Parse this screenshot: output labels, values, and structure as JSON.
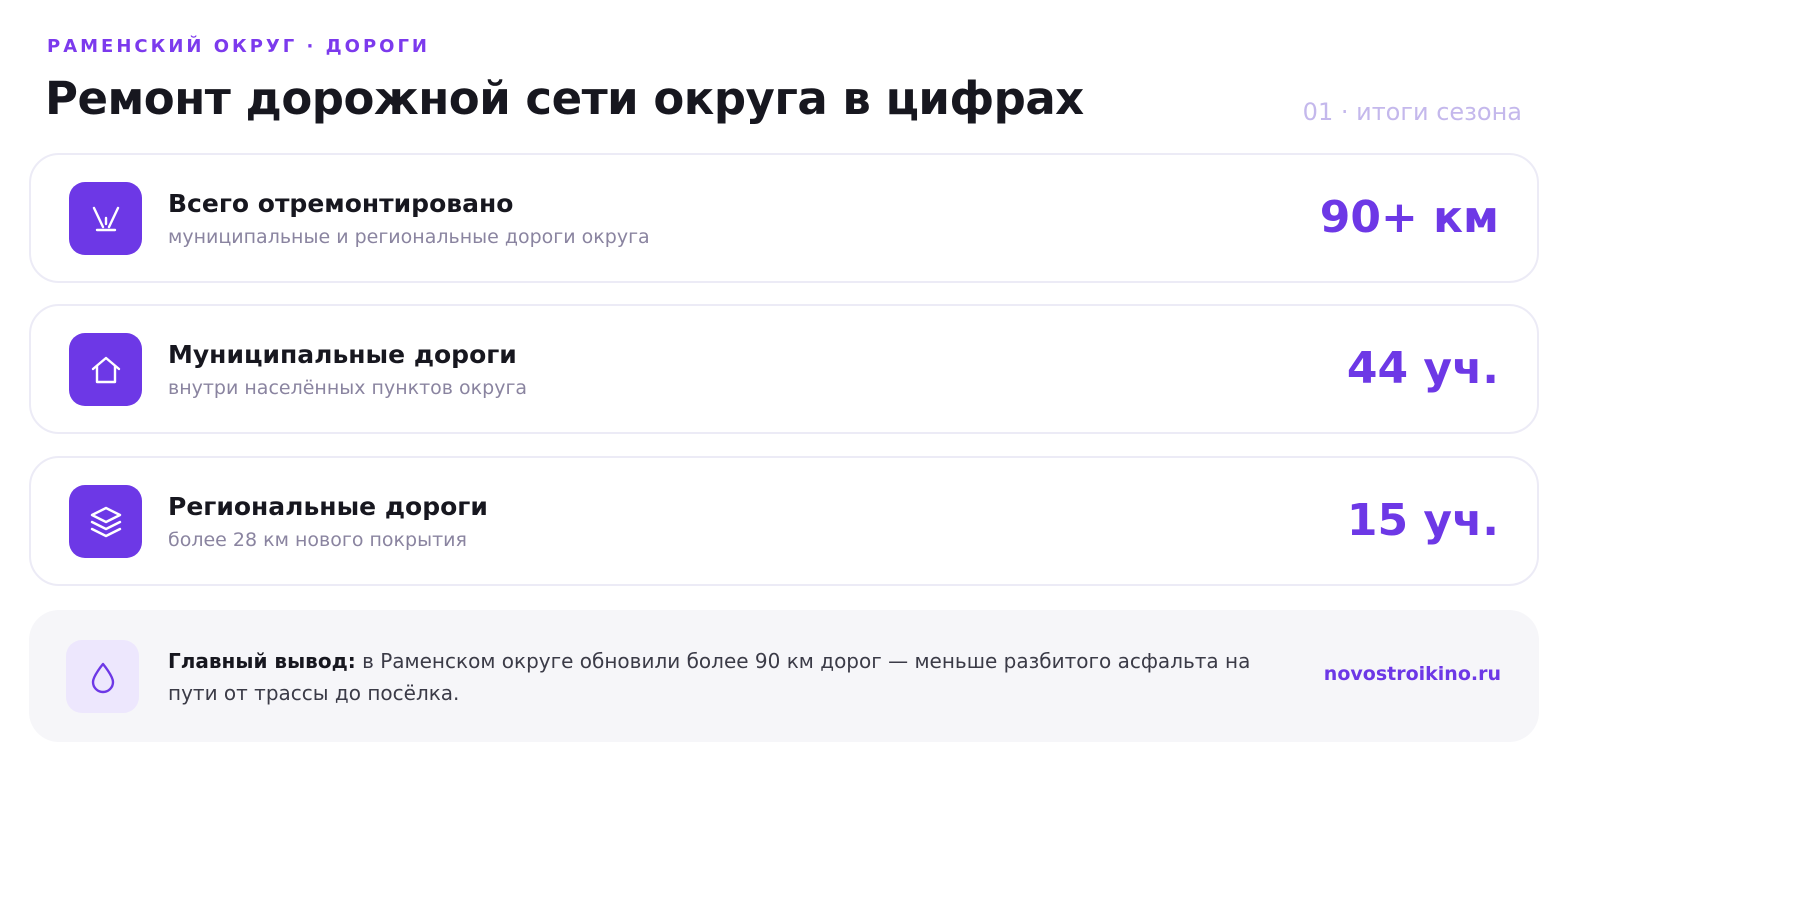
{
  "header": {
    "kicker": "РАМЕНСКИЙ ОКРУГ · ДОРОГИ",
    "title": "Ремонт дорожной сети округа в цифрах",
    "note": "01 · итоги сезона"
  },
  "stats": [
    {
      "icon": "road-icon",
      "title": "Всего отремонтировано",
      "subtitle": "муниципальные и региональные дороги округа",
      "value": "90+ км"
    },
    {
      "icon": "home-icon",
      "title": "Муниципальные дороги",
      "subtitle": "внутри населённых пунктов округа",
      "value": "44 уч."
    },
    {
      "icon": "layers-icon",
      "title": "Региональные дороги",
      "subtitle": "более 28 км нового покрытия",
      "value": "15 уч."
    }
  ],
  "summary": {
    "icon": "drop-icon",
    "lead": "Главный вывод:",
    "text": " в Раменском округе обновили более 90 км дорог — меньше разбитого асфальта на пути от трассы до посёлка.",
    "source": "novostroikino.ru"
  },
  "colors": {
    "accent": "#6d38e6",
    "kicker": "#7c3aed",
    "note": "#c4b8ec",
    "summary_bg": "#f6f6f9",
    "summary_icon_bg": "#ede7fd"
  }
}
